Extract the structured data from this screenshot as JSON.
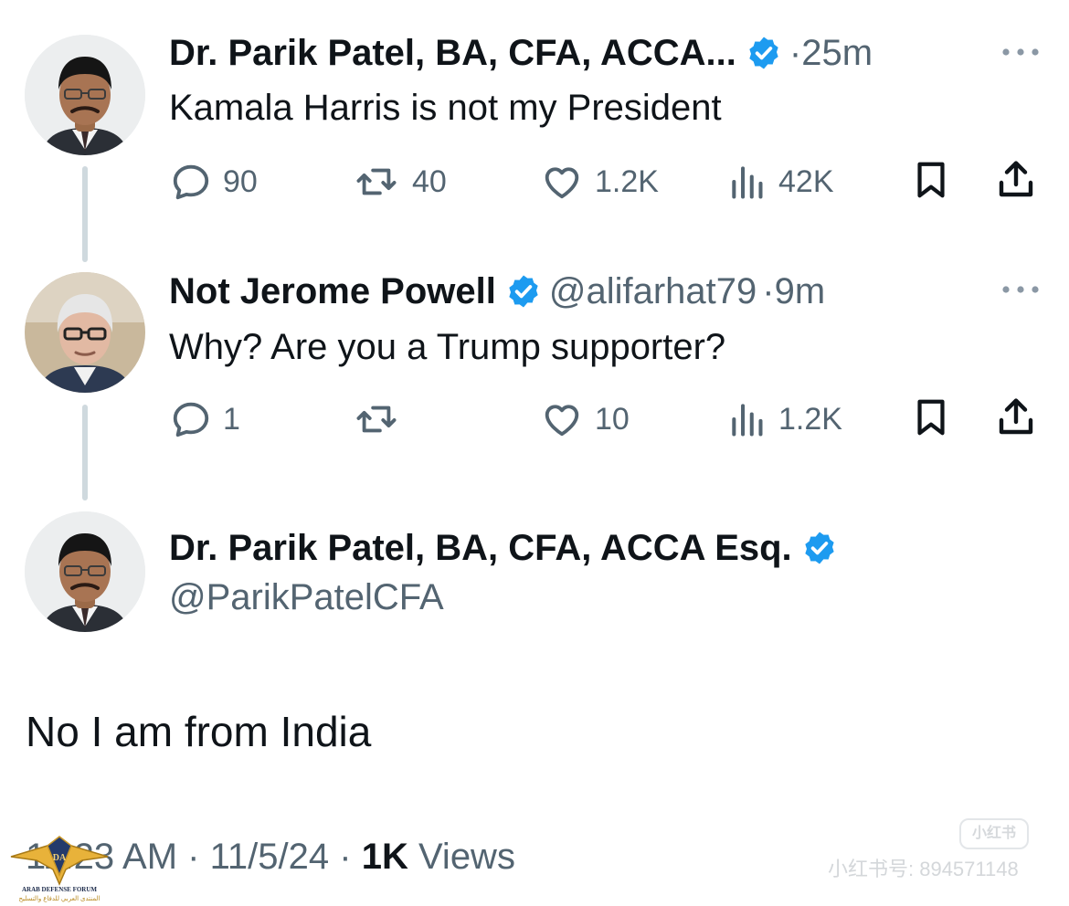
{
  "thread": {
    "tweet1": {
      "author_name": "Dr. Parik Patel, BA, CFA, ACCA...",
      "time": "·25m",
      "text": "Kamala Harris is not my President",
      "replies": "90",
      "retweets": "40",
      "likes": "1.2K",
      "views": "42K"
    },
    "tweet2": {
      "author_name": "Not Jerome Powell",
      "handle": "@alifarhat79",
      "time": "·9m",
      "text": "Why? Are you a Trump supporter?",
      "replies": "1",
      "retweets": "",
      "likes": "10",
      "views": "1.2K"
    }
  },
  "main_tweet": {
    "author_name": "Dr. Parik Patel, BA, CFA, ACCA Esq.",
    "handle": "@ParikPatelCFA",
    "text": "No I am from India",
    "time": "11:23 AM",
    "separator": "·",
    "date": "11/5/24",
    "views_count": "1K",
    "views_label": "Views"
  },
  "watermarks": {
    "xhs_logo": "小红书",
    "xhs_id": "小红书号: 894571148",
    "forum_name_en": "ARAB DEFENSE FORUM",
    "forum_name_ar": "المنتدى العربي للدفاع والتسليح",
    "forum_initials": "DA"
  },
  "colors": {
    "verified_blue": "#1d9bf0",
    "text_primary": "#0f1419",
    "text_secondary": "#536471",
    "thread_line": "#cfd9de"
  },
  "icons": [
    "reply-icon",
    "retweet-icon",
    "like-icon",
    "views-icon",
    "bookmark-icon",
    "share-icon",
    "more-icon",
    "verified-badge-icon"
  ]
}
